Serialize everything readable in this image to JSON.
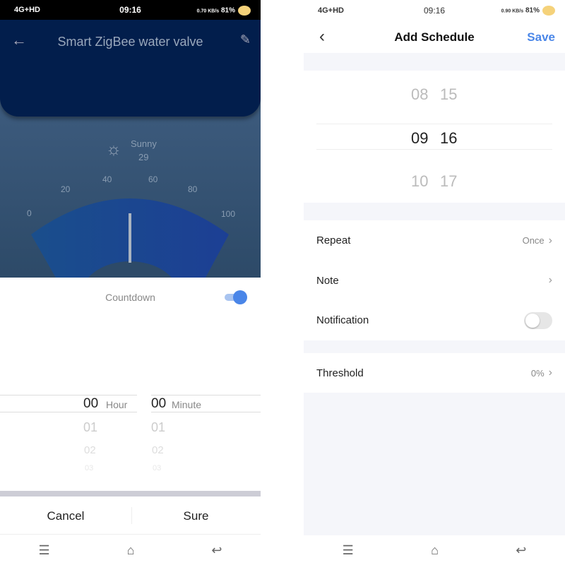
{
  "left": {
    "status": {
      "network": "4G+HD",
      "time": "09:16",
      "speed": "0.70 KB/s",
      "battery": "81%"
    },
    "title": "Smart ZigBee water valve",
    "weather": {
      "condition": "Sunny",
      "value": "29"
    },
    "gauge": {
      "ticks": [
        "0",
        "20",
        "40",
        "60",
        "80",
        "100"
      ],
      "value": 50
    },
    "countdown": {
      "label": "Countdown",
      "enabled": true,
      "accent": "#4a86e8"
    },
    "picker": {
      "hours": [
        "00",
        "01",
        "02",
        "03"
      ],
      "minutes": [
        "00",
        "01",
        "02",
        "03"
      ],
      "hour_unit": "Hour",
      "minute_unit": "Minute"
    },
    "cancel": "Cancel",
    "sure": "Sure"
  },
  "right": {
    "status": {
      "network": "4G+HD",
      "time": "09:16",
      "speed": "0.90 KB/s",
      "battery": "81%"
    },
    "title": "Add Schedule",
    "save": "Save",
    "accent": "#4a86e8",
    "time_picker": {
      "hours": [
        "08",
        "09",
        "10"
      ],
      "minutes": [
        "15",
        "16",
        "17"
      ]
    },
    "repeat": {
      "label": "Repeat",
      "value": "Once"
    },
    "note": {
      "label": "Note"
    },
    "notification": {
      "label": "Notification",
      "enabled": false
    },
    "threshold": {
      "label": "Threshold",
      "value": "0%"
    }
  }
}
